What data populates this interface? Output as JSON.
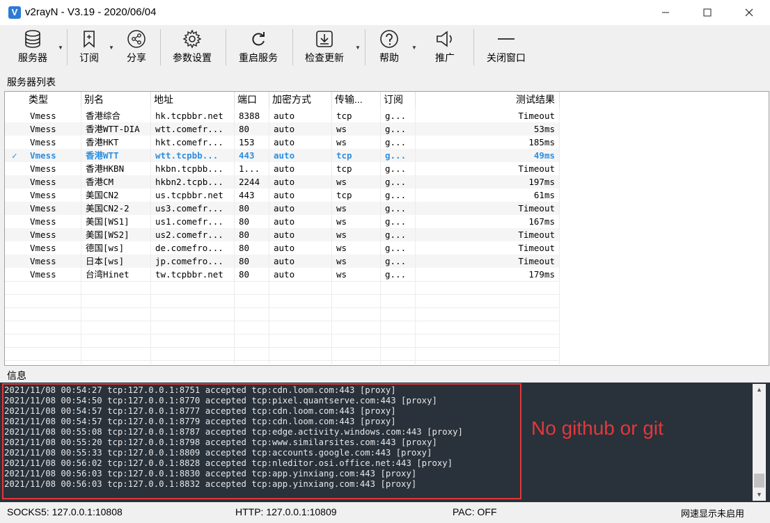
{
  "window": {
    "title": "v2rayN - V3.19 - 2020/06/04",
    "icon_letter": "V",
    "minimize_icon": "minimize-icon",
    "maximize_icon": "maximize-icon",
    "close_icon": "close-icon"
  },
  "toolbar": {
    "servers": "服务器",
    "subscribe": "订阅",
    "share": "分享",
    "settings": "参数设置",
    "restart": "重启服务",
    "check_update": "检查更新",
    "help": "帮助",
    "promote": "推广",
    "close_window": "关闭窗口"
  },
  "server_list": {
    "label": "服务器列表",
    "columns": [
      "类型",
      "别名",
      "地址",
      "端口",
      "加密方式",
      "传输...",
      "订阅",
      "测试结果"
    ],
    "rows": [
      {
        "type": "Vmess",
        "alias": "香港综合",
        "address": "hk.tcpbbr.net",
        "port": "8388",
        "security": "auto",
        "network": "tcp",
        "sub": "g...",
        "result": "Timeout"
      },
      {
        "type": "Vmess",
        "alias": "香港WTT-DIA",
        "address": "wtt.comefr...",
        "port": "80",
        "security": "auto",
        "network": "ws",
        "sub": "g...",
        "result": "53ms"
      },
      {
        "type": "Vmess",
        "alias": "香港HKT",
        "address": "hkt.comefr...",
        "port": "153",
        "security": "auto",
        "network": "ws",
        "sub": "g...",
        "result": "185ms"
      },
      {
        "type": "Vmess",
        "alias": "香港WTT",
        "address": "wtt.tcpbb...",
        "port": "443",
        "security": "auto",
        "network": "tcp",
        "sub": "g...",
        "result": "49ms",
        "selected": true
      },
      {
        "type": "Vmess",
        "alias": "香港HKBN",
        "address": "hkbn.tcpbb...",
        "port": "1...",
        "security": "auto",
        "network": "tcp",
        "sub": "g...",
        "result": "Timeout"
      },
      {
        "type": "Vmess",
        "alias": "香港CM",
        "address": "hkbn2.tcpb...",
        "port": "2244",
        "security": "auto",
        "network": "ws",
        "sub": "g...",
        "result": "197ms"
      },
      {
        "type": "Vmess",
        "alias": "美国CN2",
        "address": "us.tcpbbr.net",
        "port": "443",
        "security": "auto",
        "network": "tcp",
        "sub": "g...",
        "result": "61ms"
      },
      {
        "type": "Vmess",
        "alias": "美国CN2-2",
        "address": "us3.comefr...",
        "port": "80",
        "security": "auto",
        "network": "ws",
        "sub": "g...",
        "result": "Timeout"
      },
      {
        "type": "Vmess",
        "alias": "美国[WS1]",
        "address": "us1.comefr...",
        "port": "80",
        "security": "auto",
        "network": "ws",
        "sub": "g...",
        "result": "167ms"
      },
      {
        "type": "Vmess",
        "alias": "美国[WS2]",
        "address": "us2.comefr...",
        "port": "80",
        "security": "auto",
        "network": "ws",
        "sub": "g...",
        "result": "Timeout"
      },
      {
        "type": "Vmess",
        "alias": "德国[ws]",
        "address": "de.comefro...",
        "port": "80",
        "security": "auto",
        "network": "ws",
        "sub": "g...",
        "result": "Timeout"
      },
      {
        "type": "Vmess",
        "alias": "日本[ws]",
        "address": "jp.comefro...",
        "port": "80",
        "security": "auto",
        "network": "ws",
        "sub": "g...",
        "result": "Timeout"
      },
      {
        "type": "Vmess",
        "alias": "台湾Hinet",
        "address": "tw.tcpbbr.net",
        "port": "80",
        "security": "auto",
        "network": "ws",
        "sub": "g...",
        "result": "179ms"
      }
    ],
    "selected_check": "✓"
  },
  "info": {
    "label": "信息",
    "log_lines": [
      "2021/11/08 00:54:27 tcp:127.0.0.1:8751 accepted tcp:cdn.loom.com:443 [proxy]",
      "2021/11/08 00:54:50 tcp:127.0.0.1:8770 accepted tcp:pixel.quantserve.com:443 [proxy]",
      "2021/11/08 00:54:57 tcp:127.0.0.1:8777 accepted tcp:cdn.loom.com:443 [proxy]",
      "2021/11/08 00:54:57 tcp:127.0.0.1:8779 accepted tcp:cdn.loom.com:443 [proxy]",
      "2021/11/08 00:55:08 tcp:127.0.0.1:8787 accepted tcp:edge.activity.windows.com:443 [proxy]",
      "2021/11/08 00:55:20 tcp:127.0.0.1:8798 accepted tcp:www.similarsites.com:443 [proxy]",
      "2021/11/08 00:55:33 tcp:127.0.0.1:8809 accepted tcp:accounts.google.com:443 [proxy]",
      "2021/11/08 00:56:02 tcp:127.0.0.1:8828 accepted tcp:nleditor.osi.office.net:443 [proxy]",
      "2021/11/08 00:56:03 tcp:127.0.0.1:8830 accepted tcp:app.yinxiang.com:443 [proxy]",
      "2021/11/08 00:56:03 tcp:127.0.0.1:8832 accepted tcp:app.yinxiang.com:443 [proxy]"
    ],
    "annotation": "No github or git",
    "annotation_color": "#e3383a"
  },
  "status": {
    "socks": "SOCKS5:  127.0.0.1:10808",
    "http": "HTTP:  127.0.0.1:10809",
    "pac": "PAC:  OFF",
    "speed": "网速显示未启用"
  },
  "colors": {
    "selected_row_text": "#2d8fe0",
    "console_bg": "#29313a"
  }
}
